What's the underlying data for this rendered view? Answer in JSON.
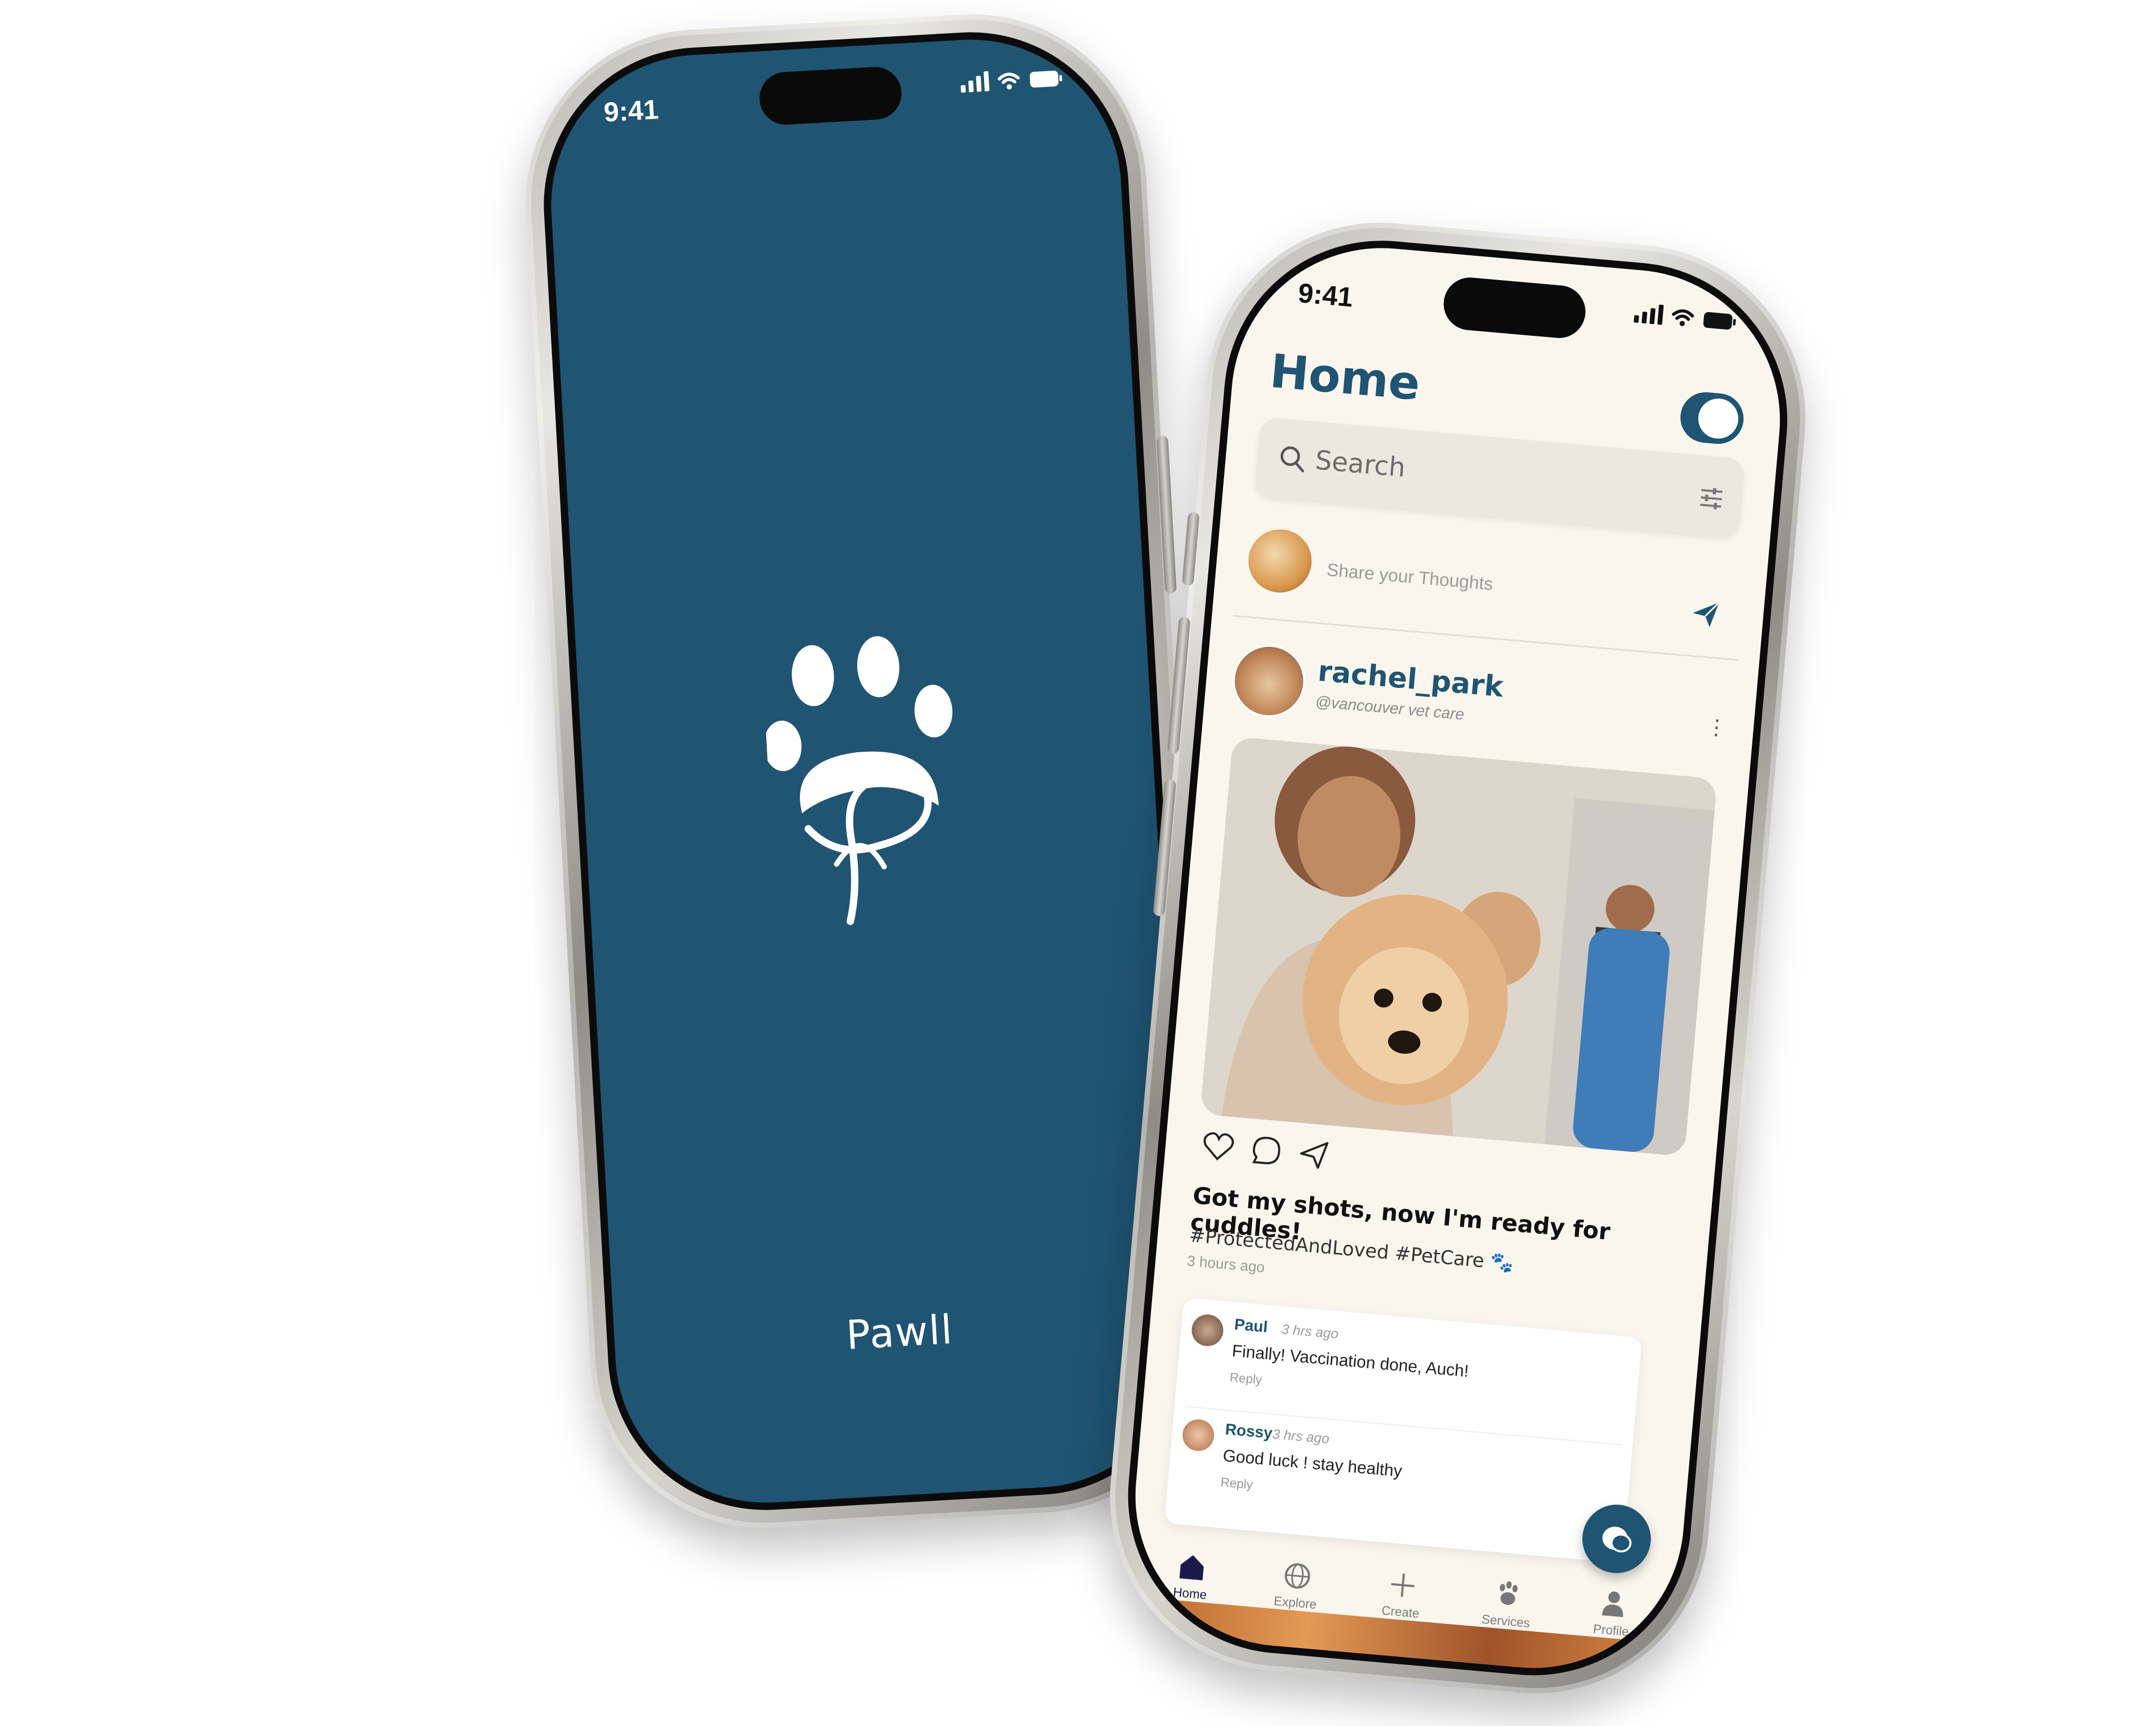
{
  "colors": {
    "brand": "#1f5473",
    "background": "#faf6ee",
    "white": "#ffffff"
  },
  "left_phone": {
    "status_time": "9:41",
    "logo_icon": "paw-print-p-logo-icon",
    "app_name": "Pawll"
  },
  "right_phone": {
    "status_time": "9:41",
    "title": "Home",
    "search": {
      "placeholder": "Search",
      "filter_icon": "sliders-icon"
    },
    "share": {
      "placeholder": "Share your Thoughts",
      "send_icon": "paper-plane-icon"
    },
    "post": {
      "username": "rachel_park",
      "handle": "@vancouver vet care",
      "caption": "Got my shots, now I'm ready for cuddles!",
      "tags": "#ProtectedAndLoved #PetCare 🐾",
      "time_ago": "3 hours ago",
      "action_icons": [
        "heart-icon",
        "comment-icon",
        "share-icon"
      ]
    },
    "comments": [
      {
        "name": "Paul",
        "time": "3 hrs ago",
        "text": "Finally! Vaccination done, Auch!",
        "reply": "Reply"
      },
      {
        "name": "Rossy",
        "time": "3 hrs ago",
        "text": "Good luck ! stay healthy",
        "reply": "Reply"
      }
    ],
    "tabs": [
      {
        "label": "Home",
        "icon": "home-icon",
        "active": true
      },
      {
        "label": "Explore",
        "icon": "globe-icon",
        "active": false
      },
      {
        "label": "Create",
        "icon": "plus-icon",
        "active": false
      },
      {
        "label": "Services",
        "icon": "paw-icon",
        "active": false
      },
      {
        "label": "Profile",
        "icon": "user-icon",
        "active": false
      }
    ]
  }
}
